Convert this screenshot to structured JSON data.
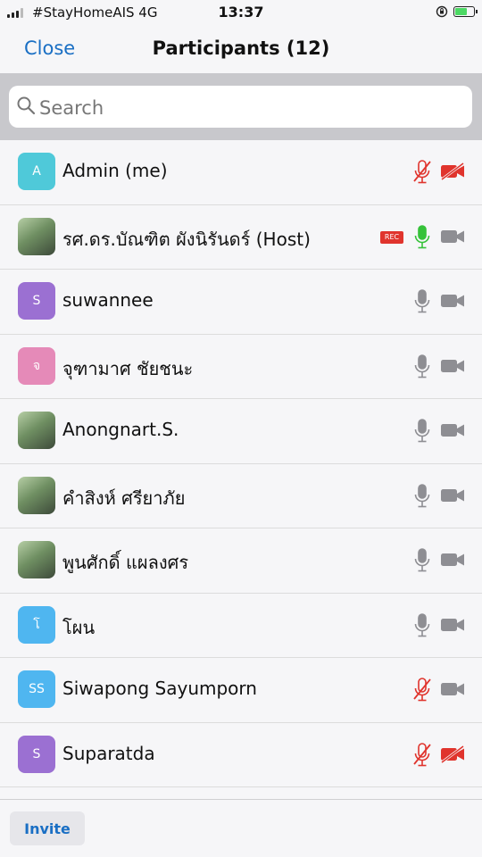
{
  "status_bar": {
    "carrier": "#StayHomeAIS   4G",
    "time": "13:37",
    "icons": [
      "signal-icon",
      "rotation-lock-icon",
      "battery-charging-icon"
    ]
  },
  "nav": {
    "close_label": "Close",
    "title": "Participants (12)"
  },
  "search": {
    "placeholder": "Search",
    "value": ""
  },
  "colors": {
    "accent": "#1a6fc4",
    "muted_red": "#e0342d",
    "mic_active": "#36c23a",
    "icon_gray": "#8e8e93"
  },
  "participants": [
    {
      "initials": "A",
      "avatar_color": "#4fc9d9",
      "name": "Admin (me)",
      "rec": "",
      "mic": "muted",
      "video": "off"
    },
    {
      "initials": "",
      "avatar_color": "photo",
      "name": "รศ.ดร.บัณฑิต      ผังนิรันดร์ (Host)",
      "rec": "REC",
      "mic": "active",
      "video": "on"
    },
    {
      "initials": "S",
      "avatar_color": "#9b70d2",
      "name": "suwannee",
      "rec": "",
      "mic": "on",
      "video": "on"
    },
    {
      "initials": "จ",
      "avatar_color": "#e58ab8",
      "name": "จุฑามาศ  ชัยชนะ",
      "rec": "",
      "mic": "on",
      "video": "on"
    },
    {
      "initials": "",
      "avatar_color": "photo",
      "name": "Anongnart.S.",
      "rec": "",
      "mic": "on",
      "video": "on"
    },
    {
      "initials": "",
      "avatar_color": "photo",
      "name": "คำสิงห์ ศรียาภัย",
      "rec": "",
      "mic": "on",
      "video": "on"
    },
    {
      "initials": "",
      "avatar_color": "photo",
      "name": "พูนศักดิ์ แผลงศร",
      "rec": "",
      "mic": "on",
      "video": "on"
    },
    {
      "initials": "โ",
      "avatar_color": "#4fb6f0",
      "name": "โผน",
      "rec": "",
      "mic": "on",
      "video": "on"
    },
    {
      "initials": "SS",
      "avatar_color": "#4fb6f0",
      "name": "Siwapong Sayumporn",
      "rec": "",
      "mic": "muted",
      "video": "on"
    },
    {
      "initials": "S",
      "avatar_color": "#9b70d2",
      "name": "Suparatda",
      "rec": "",
      "mic": "muted",
      "video": "off"
    },
    {
      "initials": "",
      "avatar_color": "#9b70d2",
      "name": "",
      "rec": "",
      "mic": "",
      "video": ""
    }
  ],
  "footer": {
    "invite_label": "Invite"
  }
}
